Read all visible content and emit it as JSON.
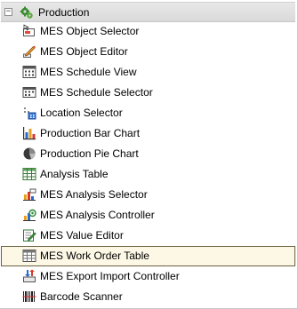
{
  "group": {
    "toggle_symbol": "−",
    "icon": "production-gears-icon",
    "label": "Production"
  },
  "items": [
    {
      "label": "MES Object Selector",
      "icon": "object-selector-icon"
    },
    {
      "label": "MES Object Editor",
      "icon": "object-editor-icon"
    },
    {
      "label": "MES Schedule View",
      "icon": "schedule-view-icon"
    },
    {
      "label": "MES Schedule Selector",
      "icon": "schedule-selector-icon"
    },
    {
      "label": "Location Selector",
      "icon": "location-selector-icon"
    },
    {
      "label": "Production Bar Chart",
      "icon": "bar-chart-icon"
    },
    {
      "label": "Production Pie Chart",
      "icon": "pie-chart-icon"
    },
    {
      "label": "Analysis Table",
      "icon": "table-icon"
    },
    {
      "label": "MES Analysis Selector",
      "icon": "analysis-selector-icon"
    },
    {
      "label": "MES Analysis Controller",
      "icon": "analysis-controller-icon"
    },
    {
      "label": "MES Value Editor",
      "icon": "value-editor-icon"
    },
    {
      "label": "MES Work Order Table",
      "icon": "work-order-table-icon",
      "selected": true
    },
    {
      "label": "MES Export Import Controller",
      "icon": "export-import-icon"
    },
    {
      "label": "Barcode Scanner",
      "icon": "barcode-scanner-icon"
    }
  ]
}
